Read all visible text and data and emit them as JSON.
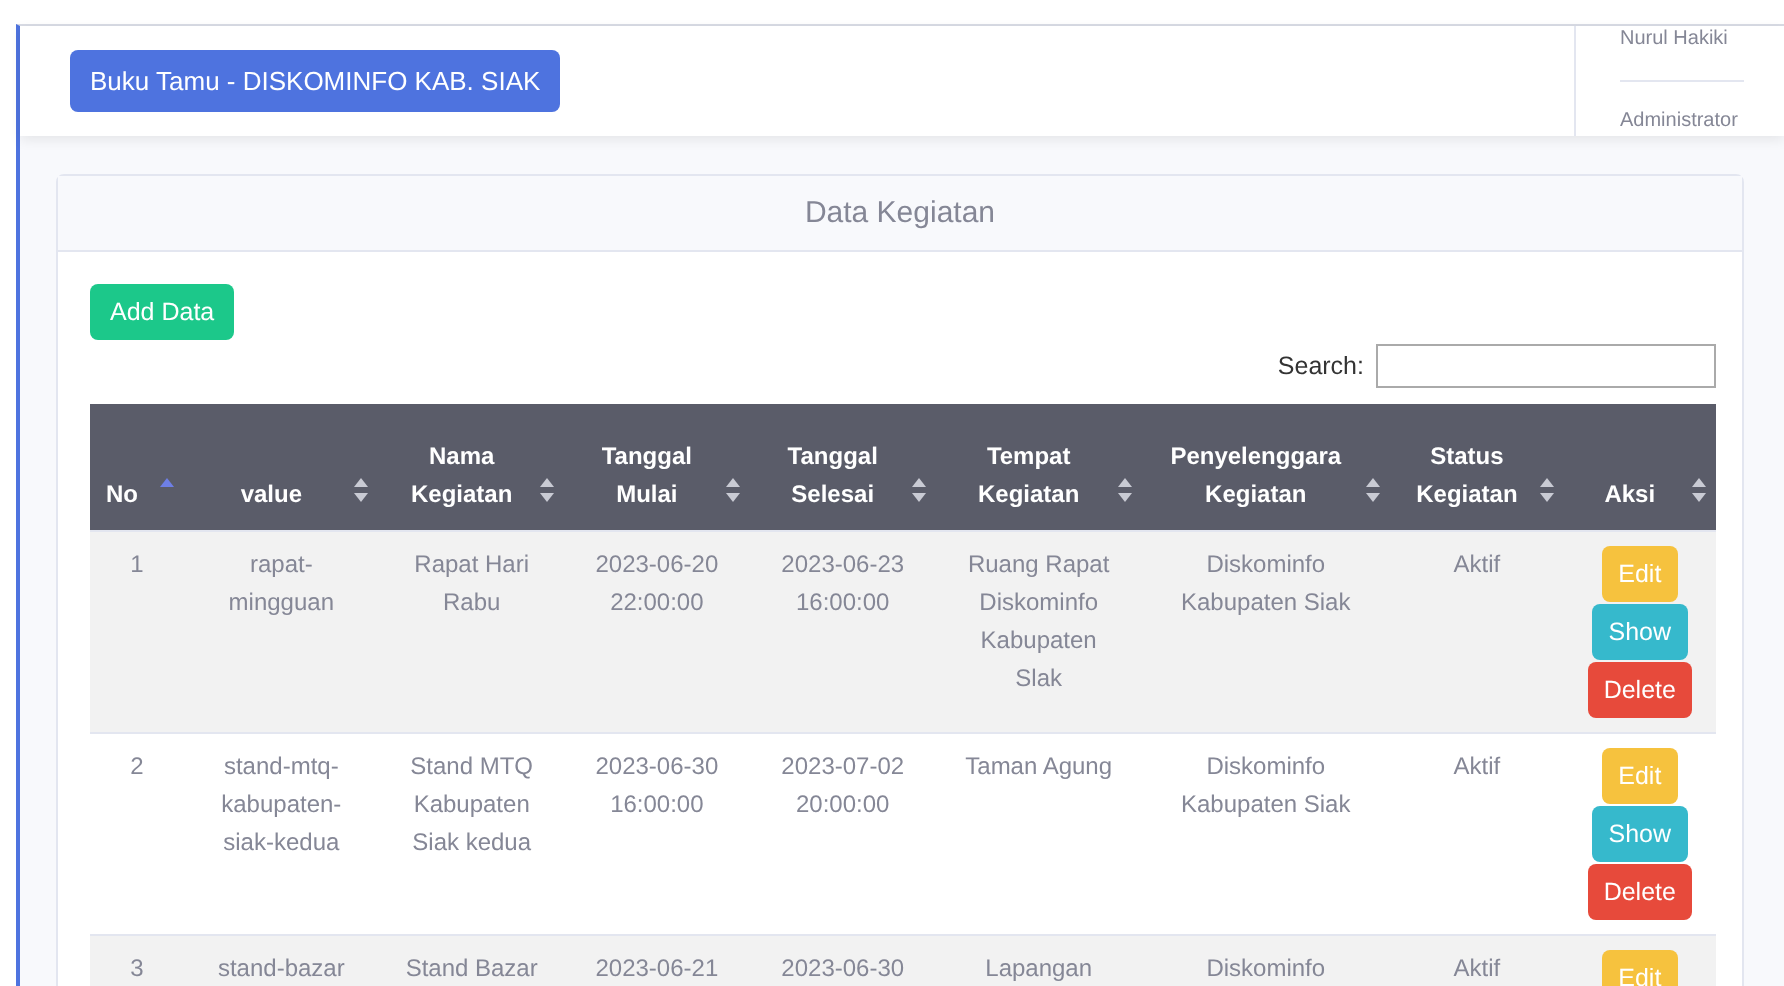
{
  "navbar": {
    "brand": "Buku Tamu - DISKOMINFO KAB. SIAK",
    "user": {
      "name": "Nurul Hakiki",
      "role": "Administrator"
    }
  },
  "card": {
    "title": "Data Kegiatan",
    "add_button": "Add Data",
    "search": {
      "label": "Search:"
    },
    "table": {
      "columns": [
        {
          "label": "No",
          "sorted": true
        },
        {
          "label": "value",
          "sorted": false
        },
        {
          "label": "Nama Kegiatan",
          "sorted": false
        },
        {
          "label": "Tanggal Mulai",
          "sorted": false
        },
        {
          "label": "Tanggal Selesai",
          "sorted": false
        },
        {
          "label": "Tempat Kegiatan",
          "sorted": false
        },
        {
          "label": "Penyelenggara Kegiatan",
          "sorted": false
        },
        {
          "label": "Status Kegiatan",
          "sorted": false
        },
        {
          "label": "Aksi",
          "sorted": false
        }
      ],
      "rows": [
        {
          "cells": [
            "1",
            "rapat-mingguan",
            "Rapat Hari Rabu",
            "2023-06-20 22:00:00",
            "2023-06-23 16:00:00",
            "Ruang Rapat Diskominfo Kabupaten Slak",
            "Diskominfo Kabupaten Siak",
            "Aktif"
          ],
          "actions": [
            "Edit",
            "Show",
            "Delete"
          ]
        },
        {
          "cells": [
            "2",
            "stand-mtq-kabupaten-siak-kedua",
            "Stand MTQ Kabupaten Siak kedua",
            "2023-06-30 16:00:00",
            "2023-07-02 20:00:00",
            "Taman Agung",
            "Diskominfo Kabupaten Siak",
            "Aktif"
          ],
          "actions": [
            "Edit",
            "Show",
            "Delete"
          ]
        },
        {
          "cells": [
            "3",
            "stand-bazar",
            "Stand Bazar",
            "2023-06-21",
            "2023-06-30",
            "Lapangan",
            "Diskominfo",
            "Aktif"
          ],
          "actions": [
            "Edit"
          ]
        }
      ]
    }
  }
}
